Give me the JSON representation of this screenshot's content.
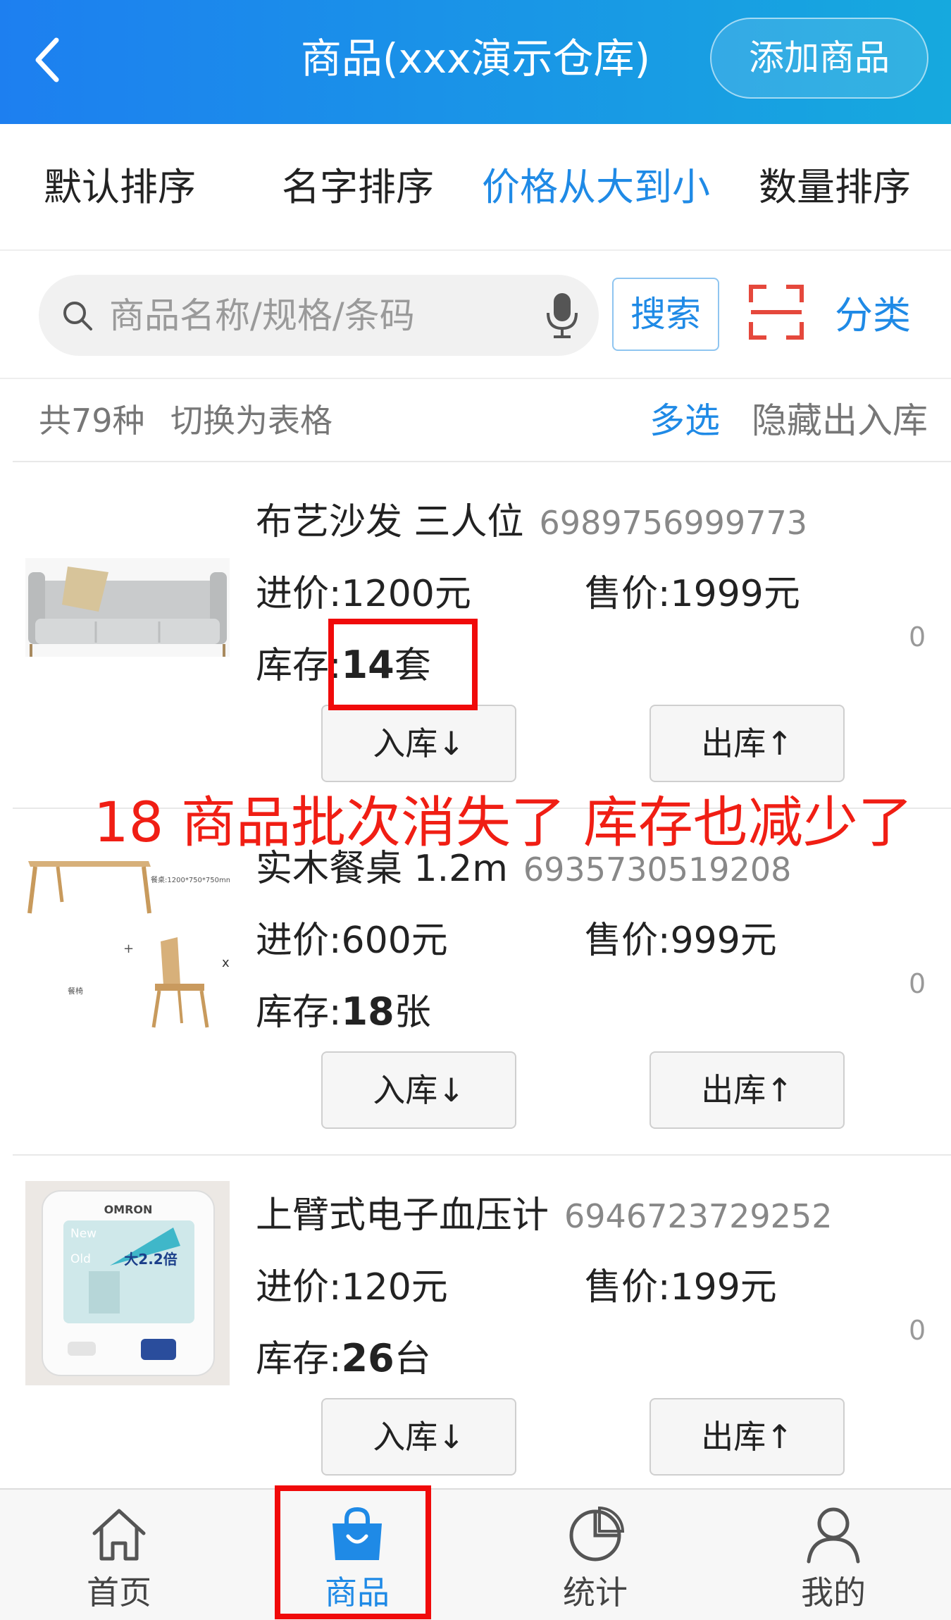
{
  "header": {
    "title": "商品(xxx演示仓库)",
    "add_button": "添加商品"
  },
  "sort_bar": {
    "items": [
      "默认排序",
      "名字排序",
      "价格从大到小",
      "数量排序"
    ],
    "active_index": 2
  },
  "search": {
    "placeholder": "商品名称/规格/条码",
    "button": "搜索",
    "category": "分类"
  },
  "info": {
    "count": "共79种",
    "toggle_table": "切换为表格",
    "multi_select": "多选",
    "hide_io": "隐藏出入库"
  },
  "products": [
    {
      "name": "布艺沙发  三人位",
      "code": "6989756999773",
      "cost_label": "进价:",
      "cost": "1200元",
      "price_label": "售价:",
      "price": "1999元",
      "stock_label": "库存:",
      "stock_value": "14",
      "stock_unit": "套",
      "zero": "0",
      "in_button": "入库↓",
      "out_button": "出库↑"
    },
    {
      "name": "实木餐桌  1.2m",
      "code": "6935730519208",
      "cost_label": "进价:",
      "cost": "600元",
      "price_label": "售价:",
      "price": "999元",
      "stock_label": "库存:",
      "stock_value": "18",
      "stock_unit": "张",
      "zero": "0",
      "in_button": "入库↓",
      "out_button": "出库↑",
      "image_texts": [
        "餐桌:1200*750*750mm",
        "+",
        "x",
        "餐椅"
      ]
    },
    {
      "name": "上臂式电子血压计",
      "code": "6946723729252",
      "cost_label": "进价:",
      "cost": "120元",
      "price_label": "售价:",
      "price": "199元",
      "stock_label": "库存:",
      "stock_value": "26",
      "stock_unit": "台",
      "zero": "0",
      "in_button": "入库↓",
      "out_button": "出库↑",
      "image_texts": [
        "OMRON",
        "New",
        "Old",
        "大2.2倍"
      ]
    }
  ],
  "annotation": "18 商品批次消失了 库存也减少了",
  "bottom_nav": [
    {
      "label": "首页",
      "icon": "home-icon"
    },
    {
      "label": "商品",
      "icon": "shopping-bag-icon"
    },
    {
      "label": "统计",
      "icon": "pie-chart-icon"
    },
    {
      "label": "我的",
      "icon": "user-icon"
    }
  ],
  "colors": {
    "accent": "#1f8ae6",
    "header_start": "#1d7ff0",
    "header_end": "#16a9de",
    "annotation": "#f01e14"
  }
}
